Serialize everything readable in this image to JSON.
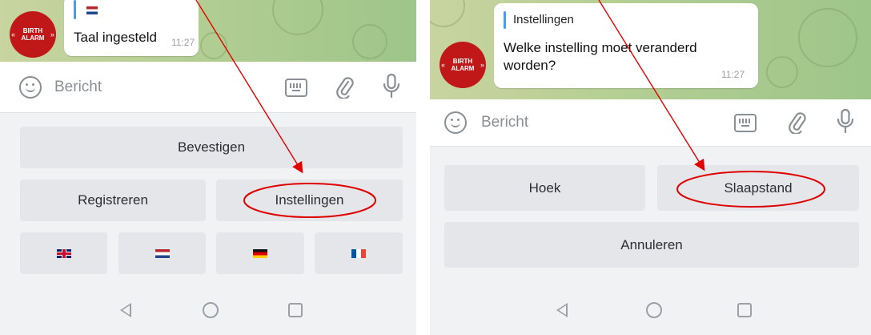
{
  "left": {
    "avatar_text": "BIRTH ALARM",
    "message": "Taal ingesteld",
    "time": "11:27",
    "input_placeholder": "Bericht",
    "keyboard": {
      "confirm": "Bevestigen",
      "register": "Registreren",
      "settings": "Instellingen"
    },
    "flags": [
      "flag-uk-icon",
      "flag-nl-icon",
      "flag-de-icon",
      "flag-fr-icon"
    ]
  },
  "right": {
    "avatar_text": "BIRTH ALARM",
    "reply_title": "Instellingen",
    "message": "Welke instelling moet veranderd worden?",
    "time": "11:27",
    "input_placeholder": "Bericht",
    "keyboard": {
      "angle": "Hoek",
      "sleep": "Slaapstand",
      "cancel": "Annuleren"
    }
  },
  "colors": {
    "annotation_red": "#e00000",
    "avatar_red": "#c01818",
    "keyboard_button": "#e4e6e9"
  }
}
